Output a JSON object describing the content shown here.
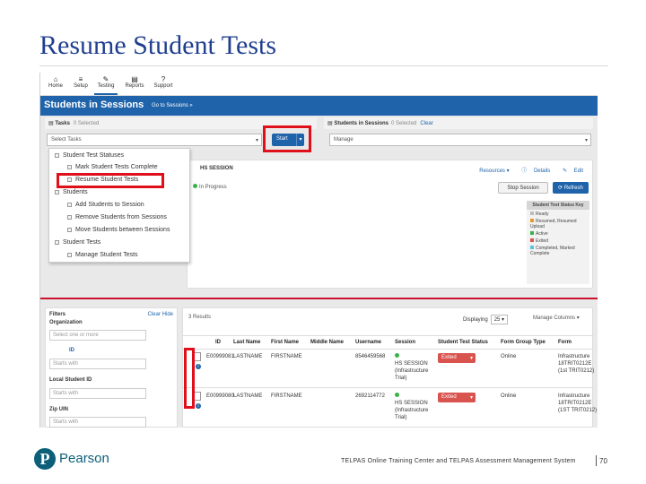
{
  "slide": {
    "title": "Resume Student Tests",
    "footer": "TELPAS Online Training Center and TELPAS Assessment Management System",
    "page_number": "70",
    "logo_text": "Pearson",
    "logo_letter": "P",
    "title_color": "#1f3f8f",
    "accent_red": "#e0101b"
  },
  "nav": {
    "items": [
      {
        "label": "Home",
        "icon": "home-icon",
        "glyph": "⌂"
      },
      {
        "label": "Setup",
        "icon": "setup-icon",
        "glyph": "≡"
      },
      {
        "label": "Testing",
        "icon": "testing-icon",
        "glyph": "✎"
      },
      {
        "label": "Reports",
        "icon": "reports-icon",
        "glyph": "▤"
      },
      {
        "label": "Support",
        "icon": "support-icon",
        "glyph": "?"
      }
    ]
  },
  "header": {
    "title": "Students in Sessions",
    "link": "Go to Sessions »"
  },
  "tasks": {
    "label": "Tasks",
    "selected": "0 Selected",
    "placeholder": "Select Tasks",
    "start": "Start",
    "menu": [
      "Student Test Statuses",
      "Mark Student Tests Complete",
      "Resume Student Tests",
      "Students",
      "Add Students to Session",
      "Remove Students from Sessions",
      "Move Students between Sessions",
      "Student Tests",
      "Manage Student Tests"
    ]
  },
  "sessions": {
    "label": "Students in Sessions",
    "selected": "0 Selected",
    "clear": "Clear",
    "manage": "Manage"
  },
  "card": {
    "session_name": "HS SESSION",
    "status": "In Progress",
    "resources": "Resources ▾",
    "details": "Details",
    "edit": "Edit",
    "stop": "Stop Session",
    "refresh": "Refresh",
    "key_title": "Student Test Status Key",
    "key": [
      {
        "label": "Ready",
        "color": "#bdbdbd"
      },
      {
        "label": "Resumed, Resumed Upload",
        "color": "#e39a2a"
      },
      {
        "label": "Active",
        "color": "#37b34a"
      },
      {
        "label": "Exited",
        "color": "#d9534f"
      },
      {
        "label": "Completed, Marked Complete",
        "color": "#5bc0de"
      }
    ]
  },
  "filters": {
    "title": "Filters",
    "clear": "Clear",
    "hide": "Hide",
    "organization": "Organization",
    "org_placeholder": "Select one or more",
    "id_label": "ID",
    "id_placeholder": "Starts with",
    "local_id_label": "Local Student ID",
    "local_placeholder": "Starts with",
    "zip_label": "Zip UIN",
    "zip_placeholder": "Starts with"
  },
  "results": {
    "count": "3 Results",
    "displaying": "Displaying",
    "page_size": "25",
    "manage_columns": "Manage Columns ▾",
    "columns": [
      "ID",
      "Last Name",
      "First Name",
      "Middle Name",
      "Username",
      "Session",
      "Student Test Status",
      "Form Group Type",
      "Form"
    ],
    "rows": [
      {
        "id": "E00999081",
        "last": "LASTNAME",
        "first": "FIRSTNAME",
        "middle": "",
        "username": "8546459568",
        "session": [
          "HS SESSION",
          "(Infrastructure",
          "Trial)"
        ],
        "status": "Exited",
        "fgt": "Online",
        "form": [
          "Infrastructure",
          "18TRIT0212E",
          "(1st TRIT0212)"
        ]
      },
      {
        "id": "E00999080",
        "last": "LASTNAME",
        "first": "FIRSTNAME",
        "middle": "",
        "username": "2692114772",
        "session": [
          "HS SESSION",
          "(Infrastructure",
          "Trial)"
        ],
        "status": "Exited",
        "fgt": "Online",
        "form": [
          "Infrastructure",
          "18TRIT0212E",
          "(1ST TRIT0212)"
        ]
      }
    ]
  }
}
